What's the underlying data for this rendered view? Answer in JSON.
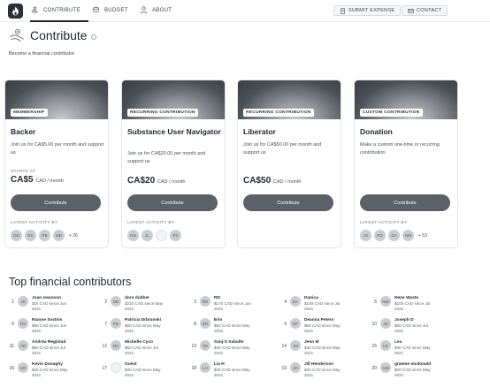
{
  "nav": {
    "contribute": "CONTRIBUTE",
    "budget": "BUDGET",
    "about": "ABOUT",
    "submit_expense": "SUBMIT EXPENSE",
    "contact": "CONTACT"
  },
  "page": {
    "title": "Contribute",
    "subtitle": "Become a financial contributor."
  },
  "tiers": [
    {
      "tag": "MEMBERSHIP",
      "name": "Backer",
      "description": "Join us for CA$5.00 per month and support us",
      "starts_at": "STARTS AT",
      "amount": "CA$5",
      "unit": "CAD / month",
      "button": "Contribute",
      "activity_label": "LATEST ACTIVITY BY",
      "avatars": [
        "DD",
        "RS",
        "RB",
        "MD"
      ],
      "more": "+ 26"
    },
    {
      "tag": "RECURRING CONTRIBUTION",
      "name": "Substance User Navigator",
      "description": "Join us for CA$20.00 per month and support us",
      "starts_at": "",
      "amount": "CA$20",
      "unit": "CAD / month",
      "button": "Contribute",
      "activity_label": "LATEST ACTIVITY BY",
      "avatars": [
        "KM",
        "JL",
        "",
        "PS"
      ],
      "more": ""
    },
    {
      "tag": "RECURRING CONTRIBUTION",
      "name": "Liberator",
      "description": "Join us for CA$50.00 per month and support us",
      "starts_at": "",
      "amount": "CA$50",
      "unit": "CAD / month",
      "button": "Contribute",
      "activity_label": "",
      "avatars": [],
      "more": ""
    },
    {
      "tag": "CUSTOM CONTRIBUTION",
      "name": "Donation",
      "description": "Make a custom one-time or recurring contribution.",
      "starts_at": "",
      "amount": "",
      "unit": "",
      "button": "Contribute",
      "activity_label": "LATEST ACTIVITY BY",
      "avatars": [
        "JS",
        "RD",
        "DA",
        "NW"
      ],
      "more": "+ 53"
    }
  ],
  "top": {
    "title": "Top financial contributors",
    "contributors": [
      {
        "rank": "1",
        "initials": "JS",
        "name": "Joan swanson",
        "amount": "$1k CAD since Jun 2021"
      },
      {
        "rank": "2",
        "initials": "DD",
        "name": "dora dubber",
        "amount": "$210 CAD since May 2021"
      },
      {
        "rank": "3",
        "initials": "RD",
        "name": "RD",
        "amount": "$170 CAD since Jun 2021"
      },
      {
        "rank": "4",
        "initials": "DA",
        "name": "Danica",
        "amount": "$100 CAD since Jul 2021"
      },
      {
        "rank": "5",
        "initials": "NW",
        "name": "Nene Waste",
        "amount": "$100 CAD since Jul 2021"
      },
      {
        "rank": "6",
        "initials": "RS",
        "name": "Rianne Svstnis",
        "amount": "$60 CAD since Jun 2021"
      },
      {
        "rank": "7",
        "initials": "PD",
        "name": "Patricia Drbranski",
        "amount": "$50 CAD since May 2021"
      },
      {
        "rank": "8",
        "initials": "ER",
        "name": "Erin",
        "amount": "$50 CAD since May 2021"
      },
      {
        "rank": "9",
        "initials": "DP",
        "name": "Deanna Peters",
        "amount": "$50 CAD since May 2021"
      },
      {
        "rank": "10",
        "initials": "JD",
        "name": "Joseph D",
        "amount": "$50 CAD since Jul 2021"
      },
      {
        "rank": "11",
        "initials": "AR",
        "name": "Andrea Regintad",
        "amount": "$50 CAD since Jul 2021"
      },
      {
        "rank": "12",
        "initials": "MC",
        "name": "Michelle Cyco",
        "amount": "$50 CAD since Jul 2021"
      },
      {
        "rank": "13",
        "initials": "SS",
        "name": "Sanj-S Saludkr",
        "amount": "$40 CAD since May 2021"
      },
      {
        "rank": "14",
        "initials": "JM",
        "name": "Jenn M",
        "amount": "$40 CAD since May 2021"
      },
      {
        "rank": "15",
        "initials": "LE",
        "name": "Lea",
        "amount": "$40 CAD since May 2021"
      },
      {
        "rank": "16",
        "initials": "KD",
        "name": "Kevin Donaghy",
        "amount": "$40 CAD since May 2021"
      },
      {
        "rank": "17",
        "initials": "",
        "name": "Guest",
        "amount": "$40 CAD since May 2021"
      },
      {
        "rank": "18",
        "initials": "LH",
        "name": "Lia H",
        "amount": "$25 CAD since May 2021"
      },
      {
        "rank": "19",
        "initials": "JH",
        "name": "Jill Henderson",
        "amount": "$20 CAD since May 2021"
      },
      {
        "rank": "20",
        "initials": "GM",
        "name": "graeme mcdonald",
        "amount": "$20 CAD since May 2021"
      }
    ]
  }
}
